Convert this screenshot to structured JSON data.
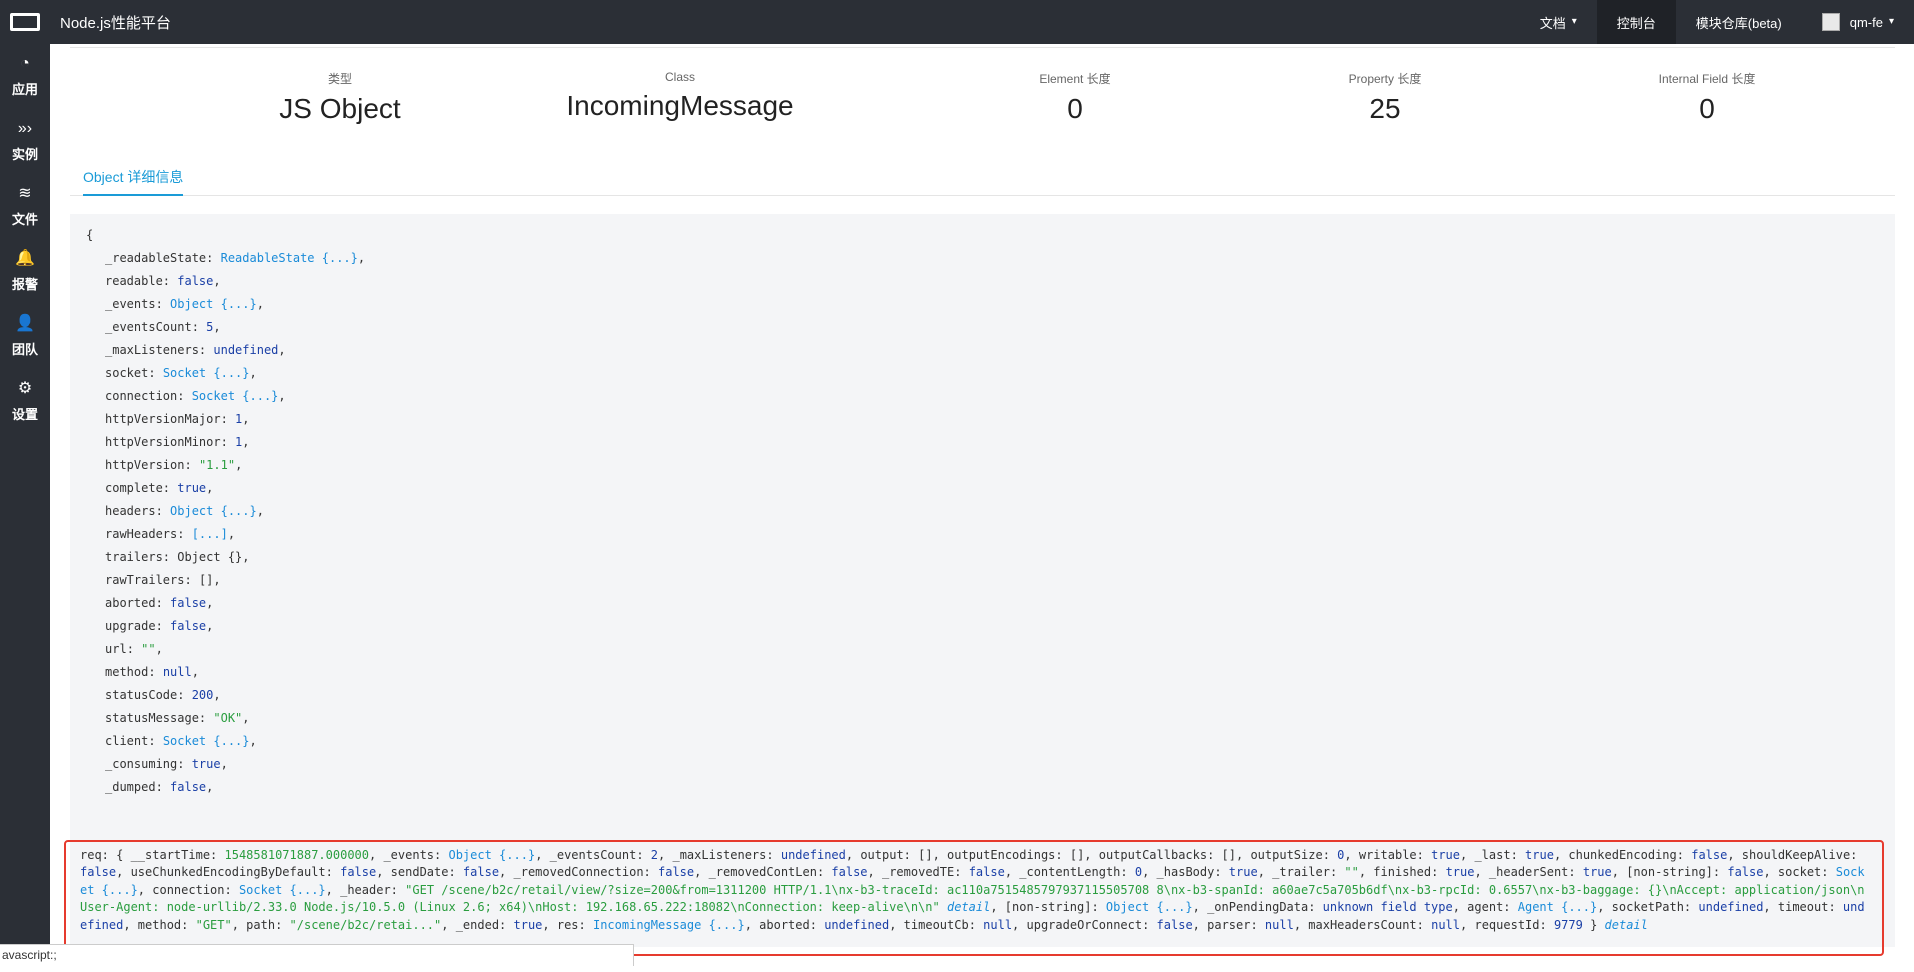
{
  "header": {
    "app_title": "Node.js性能平台",
    "nav": [
      {
        "label": "文档",
        "chevron": "▾"
      },
      {
        "label": "控制台"
      },
      {
        "label": "模块仓库(beta)"
      },
      {
        "label": "qm-fe",
        "chevron": "▾"
      }
    ]
  },
  "sidebar": {
    "items": [
      {
        "label": "应用",
        "icon": "dashboard-icon",
        "glyph": "◔"
      },
      {
        "label": "实例",
        "icon": "chevrons-right-icon",
        "glyph": "»›"
      },
      {
        "label": "文件",
        "icon": "layers-icon",
        "glyph": "≋"
      },
      {
        "label": "报警",
        "icon": "bell-icon",
        "glyph": "🔔"
      },
      {
        "label": "团队",
        "icon": "user-icon",
        "glyph": "👤"
      },
      {
        "label": "设置",
        "icon": "gear-icon",
        "glyph": "⚙"
      }
    ]
  },
  "stats": [
    {
      "label": "类型",
      "value": "JS Object"
    },
    {
      "label": "Class",
      "value": "IncomingMessage"
    },
    {
      "label": "Element 长度",
      "value": "0"
    },
    {
      "label": "Property 长度",
      "value": "25"
    },
    {
      "label": "Internal Field 长度",
      "value": "0"
    }
  ],
  "tab": {
    "label": "Object 详细信息"
  },
  "object": {
    "open": "{",
    "close": "}",
    "props": [
      {
        "key": "_readableState",
        "value": "ReadableState {...}",
        "kind": "ref"
      },
      {
        "key": "readable",
        "value": "false",
        "kind": "bool"
      },
      {
        "key": "_events",
        "value": "Object {...}",
        "kind": "ref"
      },
      {
        "key": "_eventsCount",
        "value": "5",
        "kind": "num"
      },
      {
        "key": "_maxListeners",
        "value": "undefined",
        "kind": "bool"
      },
      {
        "key": "socket",
        "value": "Socket {...}",
        "kind": "ref"
      },
      {
        "key": "connection",
        "value": "Socket {...}",
        "kind": "ref"
      },
      {
        "key": "httpVersionMajor",
        "value": "1",
        "kind": "num"
      },
      {
        "key": "httpVersionMinor",
        "value": "1",
        "kind": "num"
      },
      {
        "key": "httpVersion",
        "value": "\"1.1\"",
        "kind": "str"
      },
      {
        "key": "complete",
        "value": "true",
        "kind": "bool"
      },
      {
        "key": "headers",
        "value": "Object {...}",
        "kind": "ref"
      },
      {
        "key": "rawHeaders",
        "value": "[...]",
        "kind": "ref"
      },
      {
        "key": "trailers",
        "value": "Object {}",
        "kind": "plain"
      },
      {
        "key": "rawTrailers",
        "value": "[]",
        "kind": "plain"
      },
      {
        "key": "aborted",
        "value": "false",
        "kind": "bool"
      },
      {
        "key": "upgrade",
        "value": "false",
        "kind": "bool"
      },
      {
        "key": "url",
        "value": "\"\"",
        "kind": "str"
      },
      {
        "key": "method",
        "value": "null",
        "kind": "bool"
      },
      {
        "key": "statusCode",
        "value": "200",
        "kind": "num"
      },
      {
        "key": "statusMessage",
        "value": "\"OK\"",
        "kind": "str"
      },
      {
        "key": "client",
        "value": "Socket {...}",
        "kind": "ref"
      },
      {
        "key": "_consuming",
        "value": "true",
        "kind": "bool"
      },
      {
        "key": "_dumped",
        "value": "false",
        "kind": "bool"
      }
    ],
    "req_parts": [
      {
        "text": "req: { __startTime: ",
        "kind": "plain"
      },
      {
        "text": "1548581071887.000000",
        "kind": "str"
      },
      {
        "text": ", _events: ",
        "kind": "plain"
      },
      {
        "text": "Object {...}",
        "kind": "ref"
      },
      {
        "text": ", _eventsCount: ",
        "kind": "plain"
      },
      {
        "text": "2",
        "kind": "num"
      },
      {
        "text": ", _maxListeners: ",
        "kind": "plain"
      },
      {
        "text": "undefined",
        "kind": "bool"
      },
      {
        "text": ", output: [], outputEncodings: [], outputCallbacks: [], outputSize: ",
        "kind": "plain"
      },
      {
        "text": "0",
        "kind": "num"
      },
      {
        "text": ", writable: ",
        "kind": "plain"
      },
      {
        "text": "true",
        "kind": "bool"
      },
      {
        "text": ", _last: ",
        "kind": "plain"
      },
      {
        "text": "true",
        "kind": "bool"
      },
      {
        "text": ", chunkedEncoding: ",
        "kind": "plain"
      },
      {
        "text": "false",
        "kind": "bool"
      },
      {
        "text": ", shouldKeepAlive: ",
        "kind": "plain"
      },
      {
        "text": "false",
        "kind": "bool"
      },
      {
        "text": ", useChunkedEncodingByDefault: ",
        "kind": "plain"
      },
      {
        "text": "false",
        "kind": "bool"
      },
      {
        "text": ", sendDate: ",
        "kind": "plain"
      },
      {
        "text": "false",
        "kind": "bool"
      },
      {
        "text": ", _removedConnection: ",
        "kind": "plain"
      },
      {
        "text": "false",
        "kind": "bool"
      },
      {
        "text": ", _removedContLen: ",
        "kind": "plain"
      },
      {
        "text": "false",
        "kind": "bool"
      },
      {
        "text": ", _removedTE: ",
        "kind": "plain"
      },
      {
        "text": "false",
        "kind": "bool"
      },
      {
        "text": ", _contentLength: ",
        "kind": "plain"
      },
      {
        "text": "0",
        "kind": "num"
      },
      {
        "text": ", _hasBody: ",
        "kind": "plain"
      },
      {
        "text": "true",
        "kind": "bool"
      },
      {
        "text": ", _trailer: ",
        "kind": "plain"
      },
      {
        "text": "\"\"",
        "kind": "str"
      },
      {
        "text": ", finished: ",
        "kind": "plain"
      },
      {
        "text": "true",
        "kind": "bool"
      },
      {
        "text": ", _headerSent: ",
        "kind": "plain"
      },
      {
        "text": "true",
        "kind": "bool"
      },
      {
        "text": ", [non-string]: ",
        "kind": "plain"
      },
      {
        "text": "false",
        "kind": "bool"
      },
      {
        "text": ", socket: ",
        "kind": "plain"
      },
      {
        "text": "Socket {...}",
        "kind": "ref"
      },
      {
        "text": ", connection: ",
        "kind": "plain"
      },
      {
        "text": "Socket {...}",
        "kind": "ref"
      },
      {
        "text": ", _header: ",
        "kind": "plain"
      },
      {
        "text": "\"GET /scene/b2c/retail/view/?size=200&from=1311200 HTTP/1.1\\nx-b3-traceId: ac110a7515485797937115505708 8\\nx-b3-spanId: a60ae7c5a705b6df\\nx-b3-rpcId: 0.6557\\nx-b3-baggage: {}\\nAccept: application/json\\nUser-Agent: node-urllib/2.33.0 Node.js/10.5.0 (Linux 2.6; x64)\\nHost: 192.168.65.222:18082\\nConnection: keep-alive\\n\\n\"",
        "kind": "str"
      },
      {
        "text": " ",
        "kind": "plain"
      },
      {
        "text": "detail",
        "kind": "det"
      },
      {
        "text": ", [non-string]: ",
        "kind": "plain"
      },
      {
        "text": "Object {...}",
        "kind": "ref"
      },
      {
        "text": ", _onPendingData: ",
        "kind": "plain"
      },
      {
        "text": "unknown field type",
        "kind": "bool"
      },
      {
        "text": ", agent: ",
        "kind": "plain"
      },
      {
        "text": "Agent {...}",
        "kind": "ref"
      },
      {
        "text": ", socketPath: ",
        "kind": "plain"
      },
      {
        "text": "undefined",
        "kind": "bool"
      },
      {
        "text": ", timeout: ",
        "kind": "plain"
      },
      {
        "text": "undefined",
        "kind": "bool"
      },
      {
        "text": ", method: ",
        "kind": "plain"
      },
      {
        "text": "\"GET\"",
        "kind": "str"
      },
      {
        "text": ", path: ",
        "kind": "plain"
      },
      {
        "text": "\"/scene/b2c/retai...\"",
        "kind": "str"
      },
      {
        "text": ", _ended: ",
        "kind": "plain"
      },
      {
        "text": "true",
        "kind": "bool"
      },
      {
        "text": ", res: ",
        "kind": "plain"
      },
      {
        "text": "IncomingMessage {...}",
        "kind": "ref"
      },
      {
        "text": ", aborted: ",
        "kind": "plain"
      },
      {
        "text": "undefined",
        "kind": "bool"
      },
      {
        "text": ", timeoutCb: ",
        "kind": "plain"
      },
      {
        "text": "null",
        "kind": "bool"
      },
      {
        "text": ", upgradeOrConnect: ",
        "kind": "plain"
      },
      {
        "text": "false",
        "kind": "bool"
      },
      {
        "text": ", parser: ",
        "kind": "plain"
      },
      {
        "text": "null",
        "kind": "bool"
      },
      {
        "text": ", maxHeadersCount: ",
        "kind": "plain"
      },
      {
        "text": "null",
        "kind": "bool"
      },
      {
        "text": ", requestId: ",
        "kind": "plain"
      },
      {
        "text": "9779",
        "kind": "num"
      },
      {
        "text": " } ",
        "kind": "plain"
      },
      {
        "text": "detail",
        "kind": "det"
      }
    ]
  },
  "status_bar": {
    "text": "avascript:;"
  }
}
